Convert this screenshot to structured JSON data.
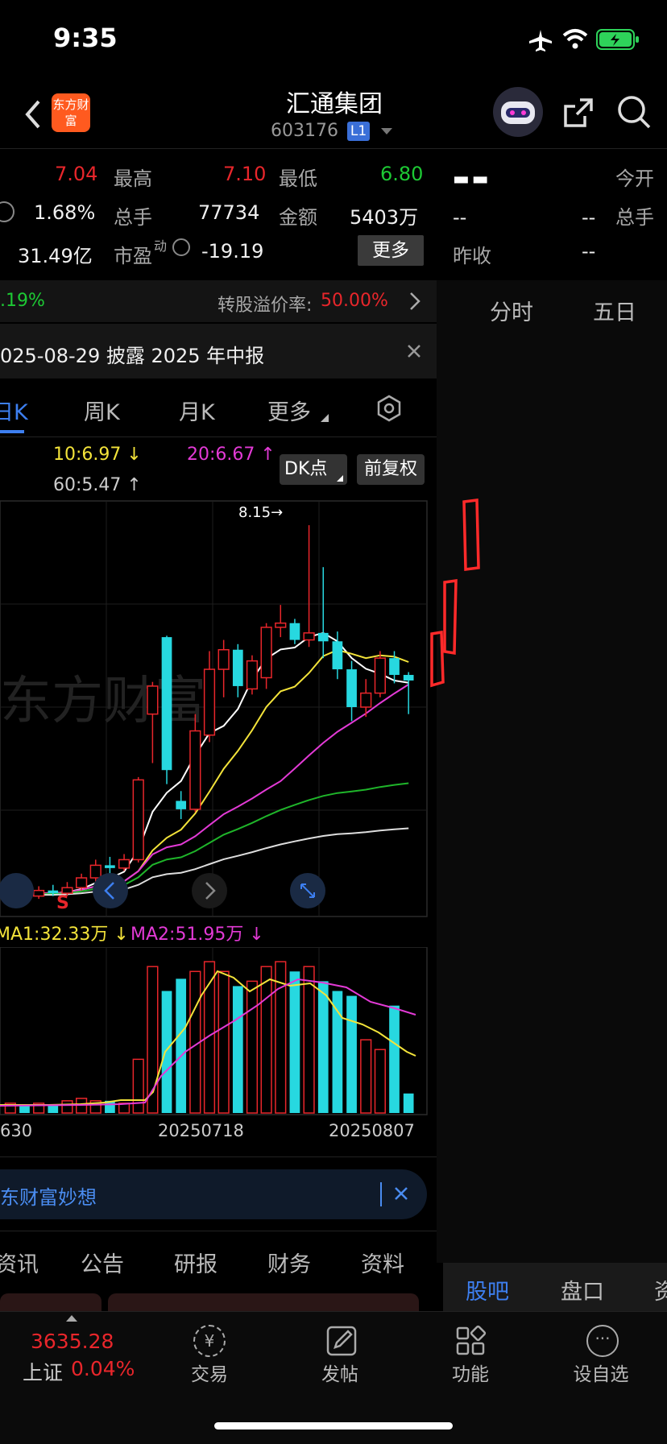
{
  "status": {
    "time": "9:35"
  },
  "header": {
    "title": "汇通集团",
    "code": "603176",
    "level": "L1",
    "logo_text": "东方财富"
  },
  "quote": {
    "price": "7.04",
    "high_label": "最高",
    "high": "7.10",
    "low_label": "最低",
    "low": "6.80",
    "turnover": "1.68%",
    "vol_label": "总手",
    "vol": "77734",
    "amount_label": "金额",
    "amount": "5403万",
    "mktcap": "31.49亿",
    "pe_label": "市盈",
    "pe_sup": "动",
    "pe": "-19.19",
    "more": "更多"
  },
  "right_panel": {
    "dash": "▬ ▬",
    "open_label": "今开",
    "vol_label": "总手",
    "v1": "--",
    "v2": "--",
    "prev_label": "昨收",
    "v3": "--",
    "tab_1": "分时",
    "tab_2": "五日"
  },
  "conv": {
    "left": ".19%",
    "label": "转股溢价率:",
    "value": "50.00%"
  },
  "notice": {
    "text": "025-08-29 披露 2025 年中报"
  },
  "ktabs": {
    "day": "日K",
    "week": "周K",
    "month": "月K",
    "more": "更多"
  },
  "ma": {
    "ma10": "10:6.97 ↓",
    "ma20": "20:6.67 ↑",
    "ma60": "60:5.47 ↑",
    "dk": "DK点",
    "fq": "前复权"
  },
  "chart": {
    "max_label": "8.15→",
    "signal": "S",
    "watermark": "东方财富",
    "vol_ma1": "MA1:32.33万 ↓",
    "vol_ma2": "MA2:51.95万 ↓",
    "date1": "630",
    "date2": "20250718",
    "date3": "20250807"
  },
  "chart_data": {
    "type": "candlestick",
    "candles": [
      {
        "o": 5.5,
        "c": 5.52,
        "h": 5.56,
        "l": 5.46
      },
      {
        "o": 5.52,
        "c": 5.5,
        "h": 5.55,
        "l": 5.47
      },
      {
        "o": 5.5,
        "c": 5.54,
        "h": 5.57,
        "l": 5.48
      },
      {
        "o": 5.54,
        "c": 5.52,
        "h": 5.58,
        "l": 5.5
      },
      {
        "o": 5.52,
        "c": 5.56,
        "h": 5.6,
        "l": 5.5
      },
      {
        "o": 5.56,
        "c": 5.63,
        "h": 5.66,
        "l": 5.54
      },
      {
        "o": 5.63,
        "c": 5.72,
        "h": 5.76,
        "l": 5.6
      },
      {
        "o": 5.72,
        "c": 5.7,
        "h": 5.78,
        "l": 5.66
      },
      {
        "o": 5.7,
        "c": 5.76,
        "h": 5.8,
        "l": 5.68
      },
      {
        "o": 5.76,
        "c": 6.33,
        "h": 6.35,
        "l": 5.74
      },
      {
        "o": 6.8,
        "c": 7.0,
        "h": 7.03,
        "l": 6.45
      },
      {
        "o": 7.35,
        "c": 6.4,
        "h": 7.36,
        "l": 6.3
      },
      {
        "o": 6.18,
        "c": 6.12,
        "h": 6.25,
        "l": 6.05
      },
      {
        "o": 6.12,
        "c": 6.68,
        "h": 6.8,
        "l": 6.1
      },
      {
        "o": 6.65,
        "c": 7.12,
        "h": 7.25,
        "l": 6.6
      },
      {
        "o": 7.12,
        "c": 7.26,
        "h": 7.33,
        "l": 6.92
      },
      {
        "o": 7.26,
        "c": 7.0,
        "h": 7.3,
        "l": 6.92
      },
      {
        "o": 6.98,
        "c": 7.18,
        "h": 7.22,
        "l": 6.94
      },
      {
        "o": 7.06,
        "c": 7.42,
        "h": 7.45,
        "l": 6.98
      },
      {
        "o": 7.42,
        "c": 7.45,
        "h": 7.58,
        "l": 7.35
      },
      {
        "o": 7.45,
        "c": 7.33,
        "h": 7.48,
        "l": 7.3
      },
      {
        "o": 7.33,
        "c": 7.38,
        "h": 8.15,
        "l": 7.28
      },
      {
        "o": 7.38,
        "c": 7.32,
        "h": 7.85,
        "l": 7.2
      },
      {
        "o": 7.32,
        "c": 7.12,
        "h": 7.39,
        "l": 7.05
      },
      {
        "o": 7.12,
        "c": 6.85,
        "h": 7.18,
        "l": 6.75
      },
      {
        "o": 6.85,
        "c": 6.95,
        "h": 7.05,
        "l": 6.78
      },
      {
        "o": 6.95,
        "c": 7.2,
        "h": 7.25,
        "l": 6.92
      },
      {
        "o": 7.2,
        "c": 7.08,
        "h": 7.25,
        "l": 7.02
      },
      {
        "o": 7.08,
        "c": 7.04,
        "h": 7.1,
        "l": 6.8
      }
    ],
    "ylim": [
      5.4,
      8.3
    ]
  },
  "banner": {
    "text": "东财富妙想"
  },
  "news_tabs": [
    "资讯",
    "公告",
    "研报",
    "财务",
    "资料"
  ],
  "right_bottom_tabs": [
    "股吧",
    "盘口",
    "资"
  ],
  "nav": {
    "index_value": "3635.28",
    "index_name": "上证",
    "index_change": "0.04%",
    "trade": "交易",
    "post": "发帖",
    "func": "功能",
    "watch": "设自选"
  }
}
